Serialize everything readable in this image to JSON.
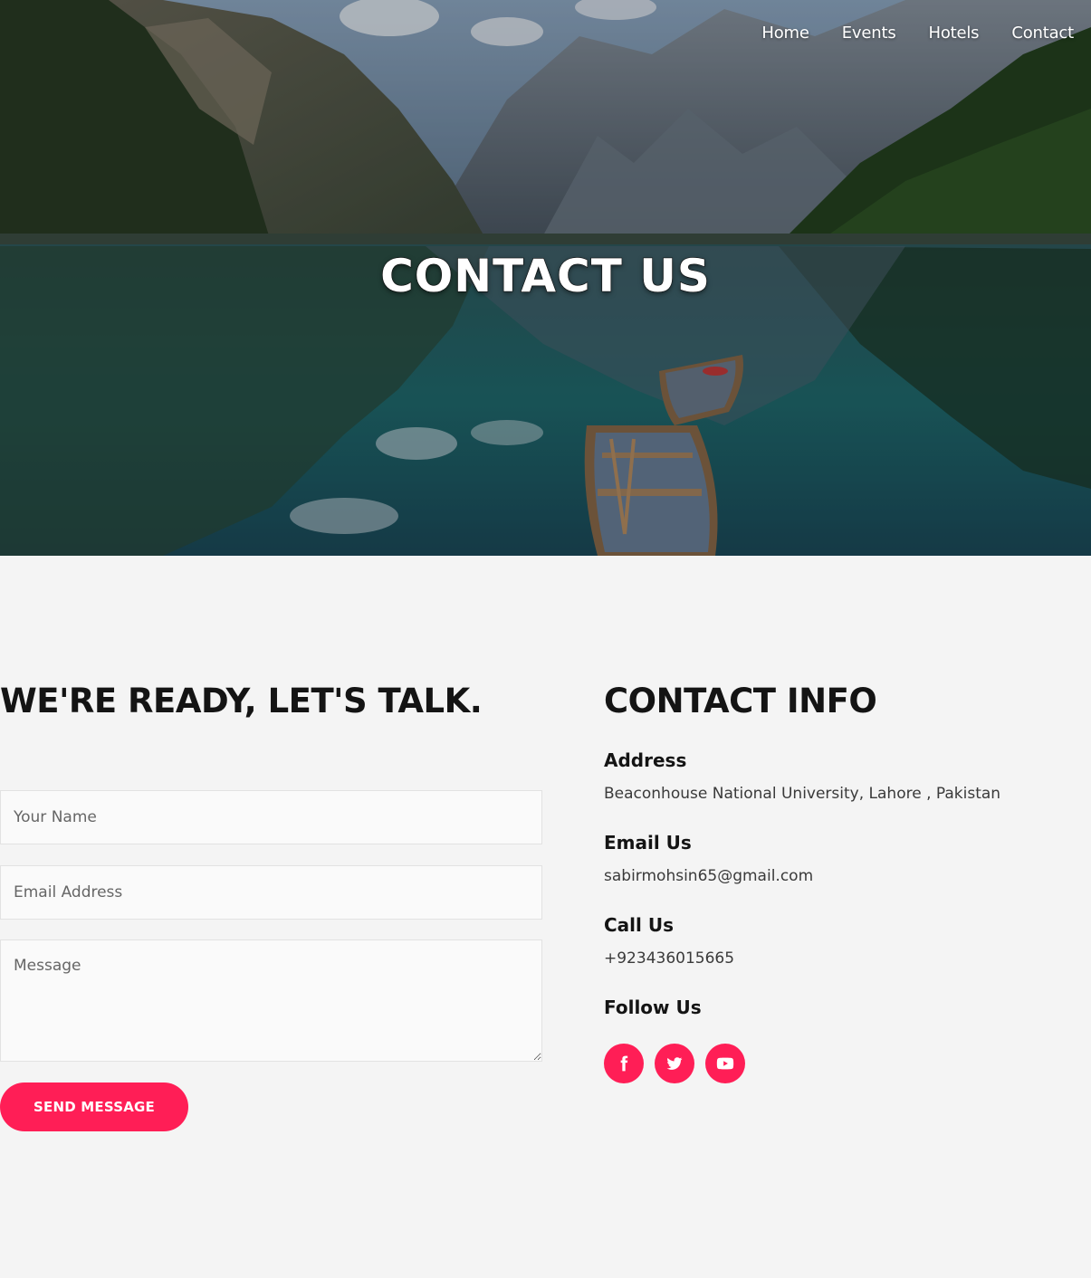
{
  "nav": {
    "items": [
      {
        "label": "Home"
      },
      {
        "label": "Events"
      },
      {
        "label": "Hotels"
      },
      {
        "label": "Contact"
      }
    ]
  },
  "hero": {
    "title": "CONTACT US"
  },
  "form": {
    "heading": "WE'RE READY, LET'S TALK.",
    "name_placeholder": "Your Name",
    "email_placeholder": "Email Address",
    "message_placeholder": "Message",
    "submit_label": "SEND MESSAGE"
  },
  "contact_info": {
    "heading": "CONTACT INFO",
    "address_label": "Address",
    "address_value": "Beaconhouse National University, Lahore , Pakistan",
    "email_label": "Email Us",
    "email_value": "sabirmohsin65@gmail.com",
    "phone_label": "Call Us",
    "phone_value": "+923436015665",
    "follow_label": "Follow Us",
    "socials": [
      {
        "icon": "facebook-icon"
      },
      {
        "icon": "twitter-icon"
      },
      {
        "icon": "youtube-icon"
      }
    ]
  },
  "colors": {
    "accent": "#ff1e56",
    "background": "#f4f4f4",
    "heading": "#141414"
  }
}
